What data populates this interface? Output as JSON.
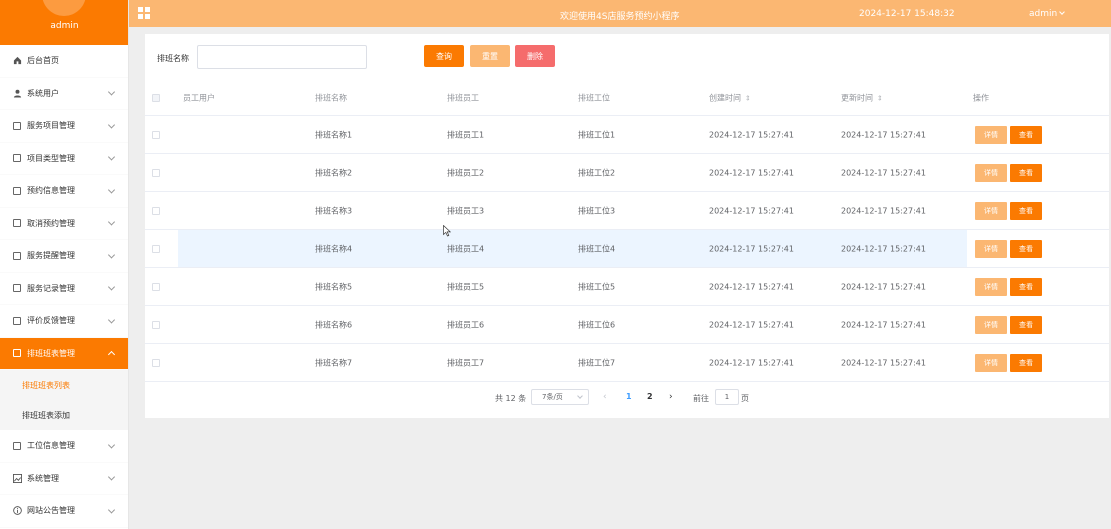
{
  "sidebar": {
    "user": "admin",
    "items": [
      {
        "label": "后台首页",
        "icon": "home-icon",
        "chevron": false
      },
      {
        "label": "系统用户",
        "icon": "user-icon",
        "chevron": true
      },
      {
        "label": "服务项目管理",
        "icon": "document-icon",
        "chevron": true
      },
      {
        "label": "项目类型管理",
        "icon": "document-icon",
        "chevron": true
      },
      {
        "label": "预约信息管理",
        "icon": "document-icon",
        "chevron": true
      },
      {
        "label": "取消预约管理",
        "icon": "document-icon",
        "chevron": true
      },
      {
        "label": "服务提醒管理",
        "icon": "document-icon",
        "chevron": true
      },
      {
        "label": "服务记录管理",
        "icon": "document-icon",
        "chevron": true
      },
      {
        "label": "评价反馈管理",
        "icon": "document-icon",
        "chevron": true
      },
      {
        "label": "排班班表管理",
        "icon": "document-icon",
        "chevron": true,
        "active": true
      },
      {
        "label": "排班班表列表",
        "sub": true,
        "current": true
      },
      {
        "label": "排班班表添加",
        "sub": true
      },
      {
        "label": "工位信息管理",
        "icon": "document-icon",
        "chevron": true
      },
      {
        "label": "系统管理",
        "icon": "image-icon",
        "chevron": true
      },
      {
        "label": "网站公告管理",
        "icon": "info-icon",
        "chevron": true
      }
    ]
  },
  "topbar": {
    "welcome": "欢迎使用4S店服务预约小程序",
    "datetime": "2024-12-17 15:48:32",
    "user": "admin"
  },
  "filter": {
    "label": "排班名称",
    "value": "",
    "placeholder": "",
    "query_label": "查询",
    "reset_label": "重置",
    "delete_label": "删除"
  },
  "table": {
    "headers": {
      "user": "员工用户",
      "name": "排班名称",
      "employee": "排班员工",
      "position": "排班工位",
      "created": "创建时间",
      "updated": "更新时间",
      "actions": "操作"
    },
    "detail_label": "详情",
    "view_label": "查看",
    "rows": [
      {
        "user": "",
        "name": "排班名称1",
        "employee": "排班员工1",
        "position": "排班工位1",
        "created": "2024-12-17 15:27:41",
        "updated": "2024-12-17 15:27:41"
      },
      {
        "user": "",
        "name": "排班名称2",
        "employee": "排班员工2",
        "position": "排班工位2",
        "created": "2024-12-17 15:27:41",
        "updated": "2024-12-17 15:27:41"
      },
      {
        "user": "",
        "name": "排班名称3",
        "employee": "排班员工3",
        "position": "排班工位3",
        "created": "2024-12-17 15:27:41",
        "updated": "2024-12-17 15:27:41"
      },
      {
        "user": "",
        "name": "排班名称4",
        "employee": "排班员工4",
        "position": "排班工位4",
        "created": "2024-12-17 15:27:41",
        "updated": "2024-12-17 15:27:41"
      },
      {
        "user": "",
        "name": "排班名称5",
        "employee": "排班员工5",
        "position": "排班工位5",
        "created": "2024-12-17 15:27:41",
        "updated": "2024-12-17 15:27:41"
      },
      {
        "user": "",
        "name": "排班名称6",
        "employee": "排班员工6",
        "position": "排班工位6",
        "created": "2024-12-17 15:27:41",
        "updated": "2024-12-17 15:27:41"
      },
      {
        "user": "",
        "name": "排班名称7",
        "employee": "排班员工7",
        "position": "排班工位7",
        "created": "2024-12-17 15:27:41",
        "updated": "2024-12-17 15:27:41"
      }
    ]
  },
  "pagination": {
    "total": "共 12 条",
    "page_size": "7条/页",
    "pages": [
      "1",
      "2"
    ],
    "current_page": "1",
    "goto_label": "前往",
    "goto_value": "1",
    "page_suffix": "页"
  },
  "colors": {
    "accent": "#fb7a01",
    "accent_light": "#fbb772",
    "danger": "#f56c6c",
    "pager_active": "#409eff"
  }
}
